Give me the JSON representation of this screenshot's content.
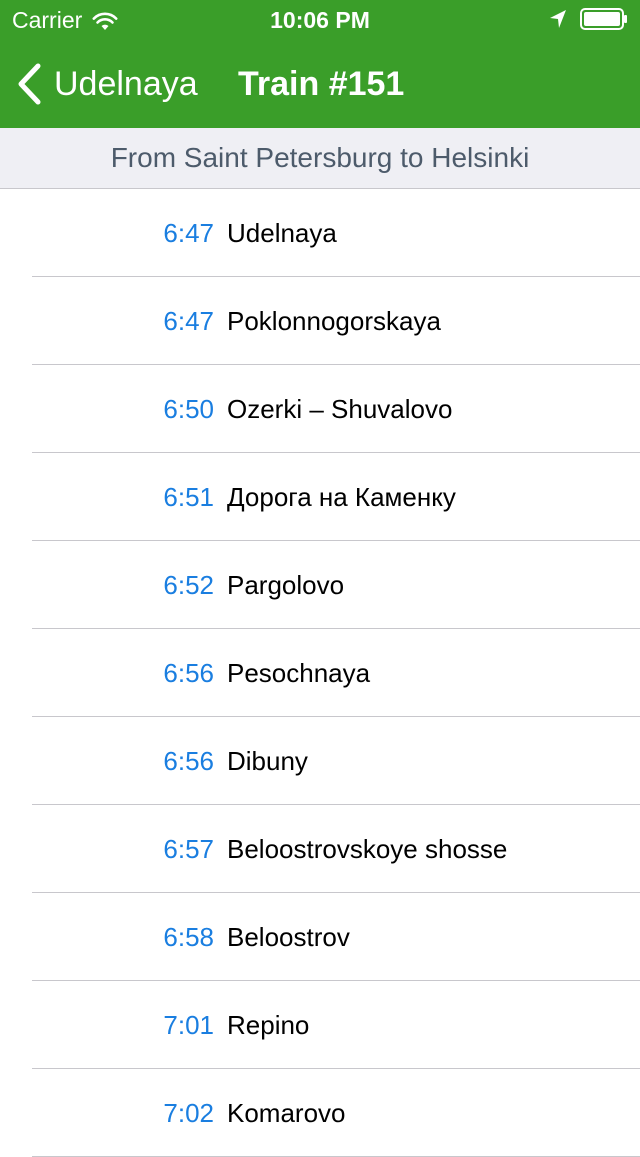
{
  "status_bar": {
    "carrier": "Carrier",
    "time": "10:06 PM",
    "icons": [
      "wifi-icon",
      "location-arrow-icon",
      "battery-icon"
    ]
  },
  "nav": {
    "back_label": "Udelnaya",
    "title": "Train #151"
  },
  "section_header": "From Saint Petersburg to Helsinki",
  "stops": [
    {
      "time": "6:47",
      "name": "Udelnaya"
    },
    {
      "time": "6:47",
      "name": "Poklonnogorskaya"
    },
    {
      "time": "6:50",
      "name": "Ozerki – Shuvalovo"
    },
    {
      "time": "6:51",
      "name": "Дорога на Каменку"
    },
    {
      "time": "6:52",
      "name": "Pargolovo"
    },
    {
      "time": "6:56",
      "name": "Pesochnaya"
    },
    {
      "time": "6:56",
      "name": "Dibuny"
    },
    {
      "time": "6:57",
      "name": "Beloostrovskoye shosse"
    },
    {
      "time": "6:58",
      "name": "Beloostrov"
    },
    {
      "time": "7:01",
      "name": "Repino"
    },
    {
      "time": "7:02",
      "name": "Komarovo"
    }
  ],
  "colors": {
    "nav_background": "#3a9e29",
    "time_text": "#1a7ee0",
    "header_background": "#efeff4",
    "header_text": "#4d5b6b",
    "separator": "#c8c7cc"
  }
}
